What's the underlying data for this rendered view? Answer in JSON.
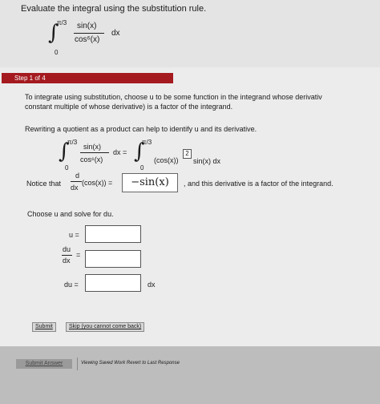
{
  "problem": {
    "title": "Evaluate the integral using the substitution rule.",
    "upper_limit": "π/3",
    "lower_limit": "0",
    "numerator": "sin(x)",
    "denominator": "cos⁶(x)",
    "differential": "dx"
  },
  "step": {
    "label": "Step 1 of 4",
    "intro_line1": "To integrate using substitution, choose u to be some function in the integrand whose derivativ",
    "intro_line2": "constant multiple of whose derivative) is a factor of the integrand.",
    "rewrite_text": "Rewriting a quotient as a product can help to identify u and its derivative.",
    "rewrite_lhs_upper": "π/3",
    "rewrite_lhs_lower": "0",
    "rewrite_lhs_num": "sin(x)",
    "rewrite_lhs_den": "cos⁶(x)",
    "rewrite_lhs_dx": "dx =",
    "rewrite_rhs_upper": "π/3",
    "rewrite_rhs_lower": "0",
    "rewrite_rhs_base": "(cos(x))",
    "rewrite_rhs_exp": "2",
    "rewrite_rhs_rest": "sin(x) dx",
    "notice_prefix": "Notice that",
    "notice_d": "d",
    "notice_dx": "dx",
    "notice_expr": "(cos(x)) =",
    "notice_answer": "−sin(x)",
    "notice_suffix": ", and this derivative is a factor of the integrand.",
    "choose_text": "Choose u and solve for du.",
    "u_label": "u =",
    "dudx_num": "du",
    "dudx_den": "dx",
    "dudx_eq": "=",
    "du_label": "du =",
    "du_suffix": "dx"
  },
  "buttons": {
    "submit": "Submit",
    "skip": "Skip (you cannot come back)",
    "submit_answer": "Submit Answer",
    "viewing": "Viewing Saved Work Revert to Last Response"
  },
  "colors": {
    "step_tab": "#a41a1f"
  }
}
